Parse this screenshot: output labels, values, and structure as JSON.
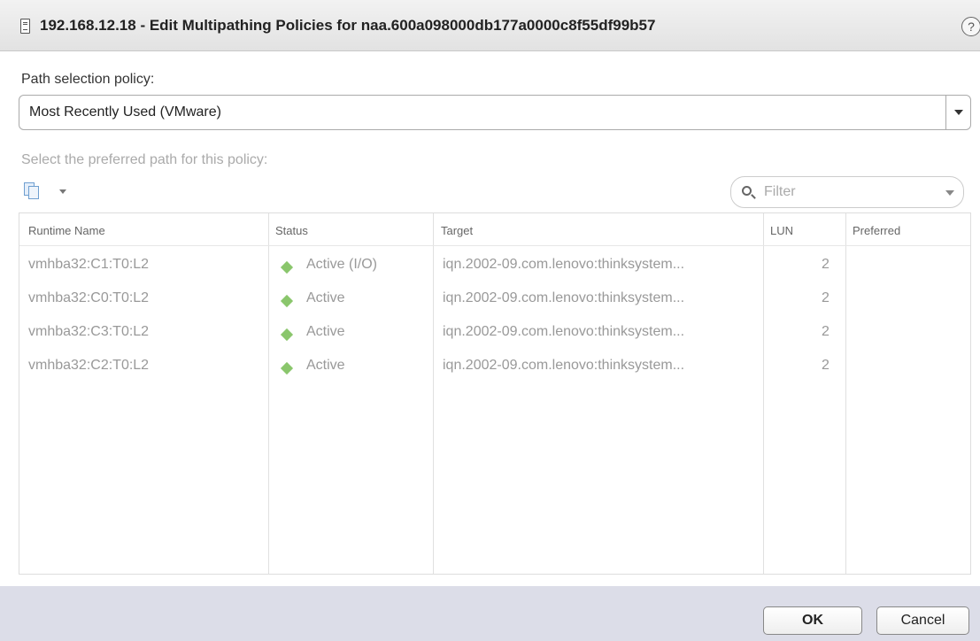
{
  "dialog": {
    "title": "192.168.12.18 - Edit Multipathing Policies for naa.600a098000db177a0000c8f55df99b57",
    "help_label": "?"
  },
  "policy": {
    "label": "Path selection policy:",
    "selected": "Most Recently Used (VMware)"
  },
  "paths": {
    "label": "Select the preferred path for this policy:",
    "filter_placeholder": "Filter",
    "columns": [
      "Runtime Name",
      "Status",
      "Target",
      "LUN",
      "Preferred"
    ],
    "rows": [
      {
        "runtime_name": "vmhba32:C1:T0:L2",
        "status": "Active (I/O)",
        "target": "iqn.2002-09.com.lenovo:thinksystem...",
        "lun": "2",
        "preferred": ""
      },
      {
        "runtime_name": "vmhba32:C0:T0:L2",
        "status": "Active",
        "target": "iqn.2002-09.com.lenovo:thinksystem...",
        "lun": "2",
        "preferred": ""
      },
      {
        "runtime_name": "vmhba32:C3:T0:L2",
        "status": "Active",
        "target": "iqn.2002-09.com.lenovo:thinksystem...",
        "lun": "2",
        "preferred": ""
      },
      {
        "runtime_name": "vmhba32:C2:T0:L2",
        "status": "Active",
        "target": "iqn.2002-09.com.lenovo:thinksystem...",
        "lun": "2",
        "preferred": ""
      }
    ],
    "status_icon": "green-diamond",
    "status_color": "#8ac66c"
  },
  "buttons": {
    "ok": "OK",
    "cancel": "Cancel"
  }
}
